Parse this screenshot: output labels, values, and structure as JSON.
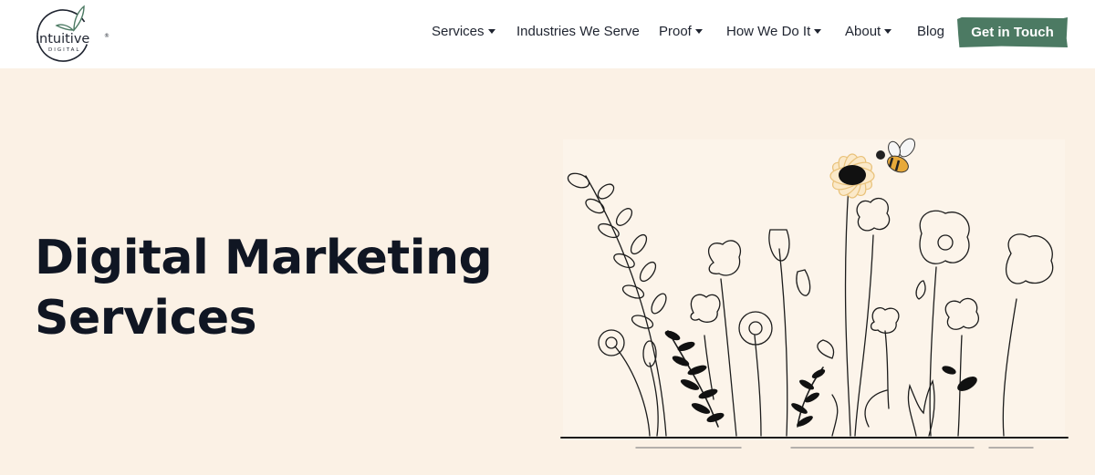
{
  "brand": {
    "logo_word": "intuitive",
    "logo_sub": "DIGITAL",
    "logo_mark": "®",
    "accent_color": "#4c7a63"
  },
  "nav": {
    "items": [
      {
        "label": "Services",
        "has_dropdown": true
      },
      {
        "label": "Industries We Serve",
        "has_dropdown": false
      },
      {
        "label": "Proof",
        "has_dropdown": true
      },
      {
        "label": "How We Do It",
        "has_dropdown": true
      },
      {
        "label": "About",
        "has_dropdown": true
      },
      {
        "label": "Blog",
        "has_dropdown": false
      }
    ],
    "cta_label": "Get in Touch"
  },
  "hero": {
    "title_line1": "Digital Marketing",
    "title_line2": "Services",
    "background_color": "#fbf1e5",
    "illustration_icon": "wildflowers-with-bee-illustration"
  }
}
